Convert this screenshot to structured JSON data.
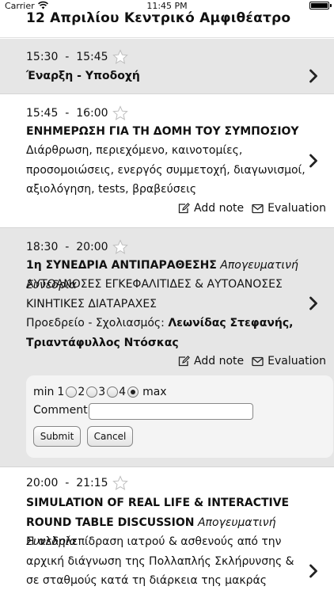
{
  "status_bar": {
    "carrier": "Carrier",
    "time": "11:45 PM"
  },
  "header": {
    "title": "12 Απριλίου  Κεντρικό Αμφιθέατρο"
  },
  "sessions": [
    {
      "time": "15:30  -  15:45",
      "title": "Έναρξη - Υποδοχή"
    },
    {
      "time": "15:45  -  16:00",
      "title": "ΕΝΗΜΕΡΩΣΗ ΓΙΑ ΤΗ ΔΟΜΗ ΤΟΥ ΣΥΜΠΟΣΙΟΥ",
      "description": "Διάρθρωση, περιεχόμενο, καινοτομίες, προσομοιώσεις, ενεργός συμμετοχή, διαγωνισμοί, αξιολόγηση, tests, βραβεύσεις",
      "add_note": "Add note",
      "evaluation": "Evaluation"
    },
    {
      "time": "18:30  -  20:00",
      "title": "1η ΣΥΝΕΔΡΙΑ ΑΝΤΙΠΑΡΑΘΕΣΗΣ",
      "subtitle": "Απογευματινή Συνεδρία",
      "topic": "ΑΥΤΟΑΝΟΣΕΣ ΕΓΚΕΦΑΛΙΤΙΔΕΣ & ΑΥΤΟΑΝΟΣΕΣ ΚΙΝΗΤΙΚΕΣ ΔΙΑΤΑΡΑΧΕΣ",
      "chair_label": "Προεδρείο - Σχολιασμός:",
      "chair_names": "Λεωνίδας Στεφανής, Τριαντάφυλλος Ντόσκας",
      "add_note": "Add note",
      "evaluation": "Evaluation",
      "eval_form": {
        "min_label": "min",
        "max_label": "max",
        "options": [
          "1",
          "2",
          "3",
          "4"
        ],
        "selected": "4",
        "comment_label": "Comment:",
        "comment_value": "",
        "submit_label": "Submit",
        "cancel_label": "Cancel"
      }
    },
    {
      "time": "20:00  -  21:15",
      "title": "SIMULATION OF REAL LIFE & INTERACTIVE ROUND TABLE DISCUSSION",
      "subtitle": "Απογευματινή Συνεδρία",
      "description": "Η αλληλεπίδραση ιατρού & ασθενούς από την αρχική διάγνωση της Πολλαπλής Σκλήρυνσης & σε σταθμούς κατά τη διάρκεια της μακράς πορείας της νόσου: μία θεατρική"
    }
  ],
  "icons": {
    "star": "star-outline-icon",
    "chevron": "chevron-right-icon",
    "note": "edit-note-icon",
    "evaluation": "envelope-icon"
  },
  "colors": {
    "grey_row": "#e6e6e6",
    "form_bg": "#f4f4f4"
  }
}
